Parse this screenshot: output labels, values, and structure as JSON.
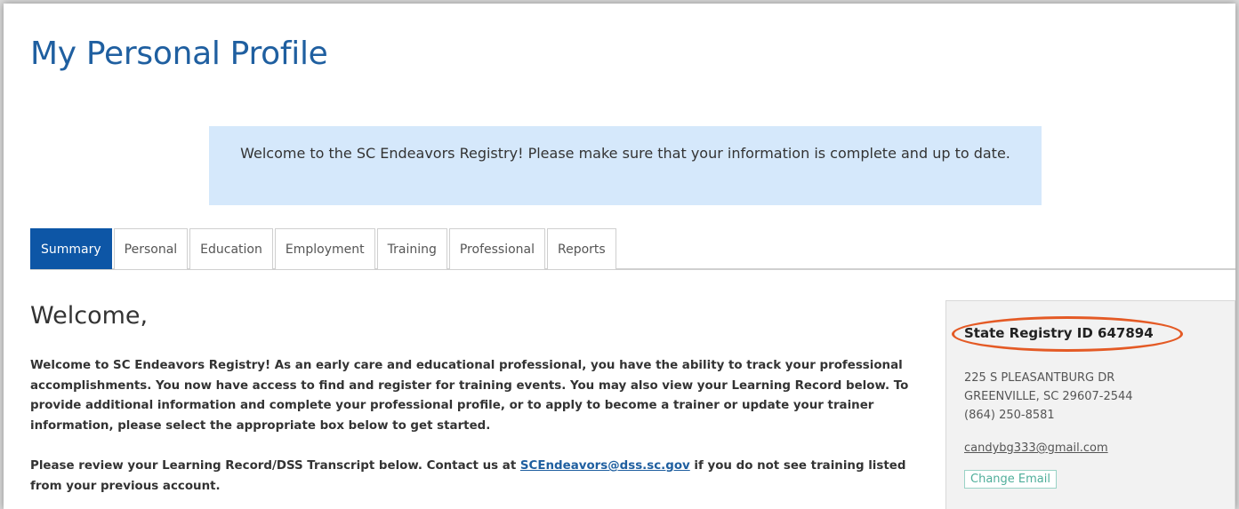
{
  "page": {
    "title": "My Personal Profile"
  },
  "alert": {
    "message": "Welcome to the SC Endeavors Registry! Please make sure that your information is complete and up to date."
  },
  "tabs": [
    {
      "label": "Summary",
      "active": true
    },
    {
      "label": "Personal",
      "active": false
    },
    {
      "label": "Education",
      "active": false
    },
    {
      "label": "Employment",
      "active": false
    },
    {
      "label": "Training",
      "active": false
    },
    {
      "label": "Professional",
      "active": false
    },
    {
      "label": "Reports",
      "active": false
    }
  ],
  "main": {
    "heading": "Welcome,",
    "paragraph1": "Welcome to SC Endeavors Registry! As an early care and educational professional, you have the ability to track your professional accomplishments. You now have access to find and register for training events. You may also view your Learning Record below. To provide additional information and complete your professional profile, or to apply to become a trainer or update your trainer information, please select the appropriate box below to get started.",
    "paragraph2_before": "Please review your Learning Record/DSS Transcript below. Contact us at ",
    "contact_email": "SCEndeavors@dss.sc.gov",
    "paragraph2_after": " if you do not see training listed from your previous account."
  },
  "side_panel": {
    "registry_id_label": "State Registry ID 647894",
    "address_line1": "225 S PLEASANTBURG DR",
    "address_line2": "GREENVILLE, SC 29607-2544",
    "phone": "(864) 250-8581",
    "email": "candybg333@gmail.com",
    "change_email_label": "Change Email"
  },
  "colors": {
    "title_blue": "#1f5fa0",
    "active_tab": "#0d56a6",
    "alert_bg": "#d5e8fb",
    "highlight_oval": "#e45a25",
    "change_email_teal": "#4fae9a"
  }
}
